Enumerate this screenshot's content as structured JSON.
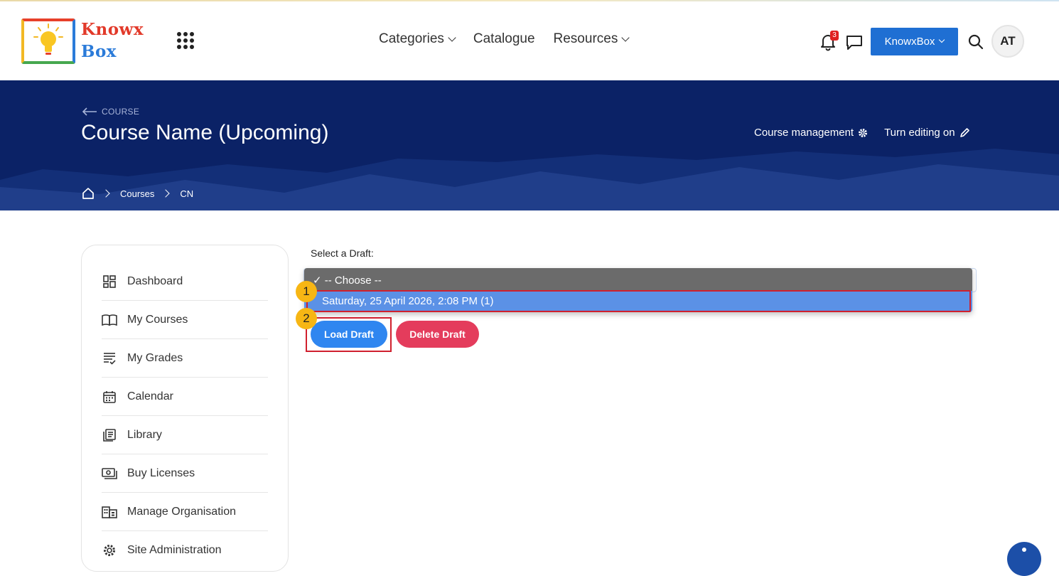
{
  "header": {
    "logo_line1": "Knowx",
    "logo_line2": "Box",
    "nav": [
      {
        "label": "Categories",
        "has_menu": true
      },
      {
        "label": "Catalogue",
        "has_menu": false
      },
      {
        "label": "Resources",
        "has_menu": true
      }
    ],
    "notification_count": "3",
    "org_button_label": "KnowxBox",
    "avatar_initials": "AT"
  },
  "banner": {
    "back_label": "COURSE",
    "title": "Course Name (Upcoming)",
    "actions": {
      "course_management": "Course management",
      "turn_editing_on": "Turn editing on"
    },
    "breadcrumb": [
      "Courses",
      "CN"
    ]
  },
  "sidebar": {
    "items": [
      {
        "label": "Dashboard",
        "icon": "dashboard-icon"
      },
      {
        "label": "My Courses",
        "icon": "book-icon"
      },
      {
        "label": "My Grades",
        "icon": "grades-icon"
      },
      {
        "label": "Calendar",
        "icon": "calendar-icon"
      },
      {
        "label": "Library",
        "icon": "library-icon"
      },
      {
        "label": "Buy Licenses",
        "icon": "license-icon"
      },
      {
        "label": "Manage Organisation",
        "icon": "organisation-icon"
      },
      {
        "label": "Site Administration",
        "icon": "gear-icon"
      }
    ]
  },
  "draft": {
    "label": "Select a Draft:",
    "choose_option": "✓ -- Choose --",
    "options": [
      "Saturday, 25 April 2026, 2:08 PM (1)"
    ],
    "load_button": "Load Draft",
    "delete_button": "Delete Draft"
  },
  "annotations": {
    "step1": "1",
    "step2": "2"
  },
  "colors": {
    "brand_blue": "#1f6fd3",
    "banner_navy": "#0b2266",
    "delete_red": "#e43c5c",
    "highlight_red": "#d0202e",
    "marker_yellow": "#f7b614"
  }
}
